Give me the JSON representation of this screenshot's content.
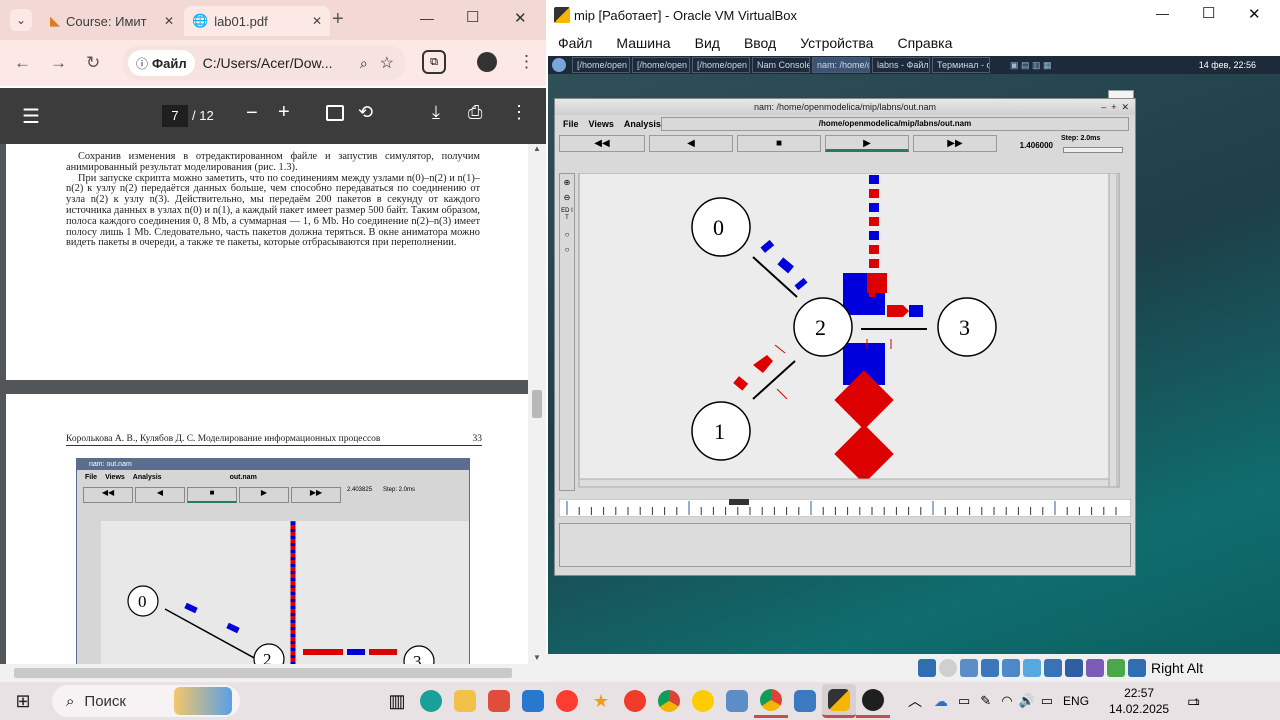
{
  "chrome": {
    "tabs": [
      {
        "title": "Course: Имит"
      },
      {
        "title": "lab01.pdf"
      }
    ],
    "new_tab": "+",
    "window_controls": {
      "minimize": "—",
      "maximize": "☐",
      "close": "✕"
    },
    "url_chip": "Файл",
    "url": "C:/Users/Acer/Dow...",
    "pdf": {
      "page_current": "7",
      "page_total": "/ 12"
    }
  },
  "pdf_text": {
    "paragraph1": "Сохранив изменения в отредактированном файле и запустив симулятор, получим анимированный результат моделирования (рис. 1.3).",
    "paragraph2": "При запуске скрипта можно заметить, что по соединениям между узлами n(0)–n(2) и n(1)–n(2) к узлу n(2) передаётся данных больше, чем способно передаваться по соединению от узла n(2) к узлу n(3). Действительно, мы передаём 200 пакетов в секунду от каждого источника данных в узлах n(0) и n(1), а каждый пакет имеет размер 500 байт. Таким образом, полоса каждого соединения 0, 8 Mb, а суммарная — 1, 6 Mb. Но соединение n(2)–n(3) имеет полосу лишь 1 Mb. Следовательно, часть пакетов должна теряться. В окне аниматора можно видеть пакеты в очереди, а также те пакеты, которые отбрасываются при переполнении.",
    "running_header": "Королькова А. В., Кулябов Д. С. Моделирование информационных процессов",
    "page_number": "33",
    "figure": {
      "title": "nam: out.nam",
      "menu": [
        "File",
        "Views",
        "Analysis"
      ],
      "file": "out.nam",
      "time": "2.403825",
      "step": "Step: 2.0ms",
      "nodes": [
        "0",
        "2",
        "3"
      ]
    }
  },
  "vbox": {
    "title": "mip [Работает] - Oracle VM VirtualBox",
    "menu": [
      "Файл",
      "Машина",
      "Вид",
      "Ввод",
      "Устройства",
      "Справка"
    ],
    "host_key": "Right Alt"
  },
  "guest": {
    "tasks": [
      "[/home/open",
      "[/home/open",
      "[/home/open",
      "Nam Console ...",
      "nam: /home/o...",
      "labns - Файло...",
      "Терминал - o..."
    ],
    "clock": "14 фев, 22:56",
    "nam": {
      "title": "nam: /home/openmodelica/mip/labns/out.nam",
      "menu": [
        "File",
        "Views",
        "Analysis"
      ],
      "file": "/home/openmodelica/mip/labns/out.nam",
      "controls": [
        "◀◀",
        "◀",
        "■",
        "▶",
        "▶▶"
      ],
      "time": "1.406000",
      "step": "Step: 2.0ms",
      "nodes": [
        "0",
        "1",
        "2",
        "3"
      ],
      "side_label": "ED IT"
    }
  },
  "taskbar": {
    "search": "Поиск",
    "lang": "ENG",
    "time": "22:57",
    "date": "14.02.2025",
    "notifications": "1"
  }
}
